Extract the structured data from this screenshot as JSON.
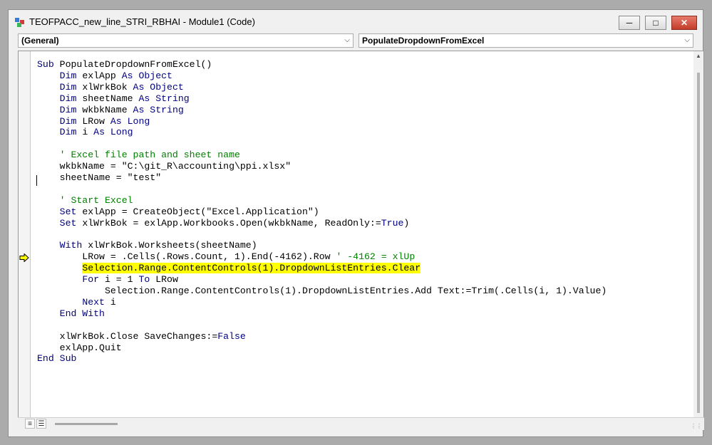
{
  "window": {
    "title": "TEOFPACC_new_line_STRI_RBHAI - Module1 (Code)",
    "controls": {
      "minimize": "─",
      "maximize": "□",
      "close": "✕"
    }
  },
  "dropdowns": {
    "object": {
      "selected": "(General)"
    },
    "procedure": {
      "selected": "PopulateDropdownFromExcel"
    }
  },
  "code": {
    "lines": [
      [
        {
          "t": "Sub",
          "c": "kw"
        },
        {
          "t": " PopulateDropdownFromExcel()"
        }
      ],
      [
        {
          "t": "    "
        },
        {
          "t": "Dim",
          "c": "kw"
        },
        {
          "t": " exlApp "
        },
        {
          "t": "As",
          "c": "kw"
        },
        {
          "t": " "
        },
        {
          "t": "Object",
          "c": "kw"
        }
      ],
      [
        {
          "t": "    "
        },
        {
          "t": "Dim",
          "c": "kw"
        },
        {
          "t": " xlWrkBok "
        },
        {
          "t": "As",
          "c": "kw"
        },
        {
          "t": " "
        },
        {
          "t": "Object",
          "c": "kw"
        }
      ],
      [
        {
          "t": "    "
        },
        {
          "t": "Dim",
          "c": "kw"
        },
        {
          "t": " sheetName "
        },
        {
          "t": "As",
          "c": "kw"
        },
        {
          "t": " "
        },
        {
          "t": "String",
          "c": "kw"
        }
      ],
      [
        {
          "t": "    "
        },
        {
          "t": "Dim",
          "c": "kw"
        },
        {
          "t": " wkbkName "
        },
        {
          "t": "As",
          "c": "kw"
        },
        {
          "t": " "
        },
        {
          "t": "String",
          "c": "kw"
        }
      ],
      [
        {
          "t": "    "
        },
        {
          "t": "Dim",
          "c": "kw"
        },
        {
          "t": " LRow "
        },
        {
          "t": "As",
          "c": "kw"
        },
        {
          "t": " "
        },
        {
          "t": "Long",
          "c": "kw"
        }
      ],
      [
        {
          "t": "    "
        },
        {
          "t": "Dim",
          "c": "kw"
        },
        {
          "t": " i "
        },
        {
          "t": "As",
          "c": "kw"
        },
        {
          "t": " "
        },
        {
          "t": "Long",
          "c": "kw"
        }
      ],
      [],
      [
        {
          "t": "    "
        },
        {
          "t": "' Excel file path and sheet name",
          "c": "cm"
        }
      ],
      [
        {
          "t": "    wkbkName = \"C:\\git_R\\accounting\\ppi.xlsx\""
        }
      ],
      [
        {
          "t": "    sheetName = \"test\""
        }
      ],
      [],
      [
        {
          "t": "    "
        },
        {
          "t": "' Start Excel",
          "c": "cm"
        }
      ],
      [
        {
          "t": "    "
        },
        {
          "t": "Set",
          "c": "kw"
        },
        {
          "t": " exlApp = CreateObject(\"Excel.Application\")"
        }
      ],
      [
        {
          "t": "    "
        },
        {
          "t": "Set",
          "c": "kw"
        },
        {
          "t": " xlWrkBok = exlApp.Workbooks.Open(wkbkName, ReadOnly:="
        },
        {
          "t": "True",
          "c": "kw"
        },
        {
          "t": ")"
        }
      ],
      [],
      [
        {
          "t": "    "
        },
        {
          "t": "With",
          "c": "kw"
        },
        {
          "t": " xlWrkBok.Worksheets(sheetName)"
        }
      ],
      [
        {
          "t": "        LRow = .Cells(.Rows.Count, 1).End(-4162).Row "
        },
        {
          "t": "' -4162 = xlUp",
          "c": "cm"
        }
      ],
      [
        {
          "t": "        "
        },
        {
          "t": "Selection.Range.ContentControls(1).DropdownListEntries.Clear",
          "c": "hl"
        }
      ],
      [
        {
          "t": "        "
        },
        {
          "t": "For",
          "c": "kw"
        },
        {
          "t": " i = 1 "
        },
        {
          "t": "To",
          "c": "kw"
        },
        {
          "t": " LRow"
        }
      ],
      [
        {
          "t": "            Selection.Range.ContentControls(1).DropdownListEntries.Add Text:=Trim(.Cells(i, 1).Value)"
        }
      ],
      [
        {
          "t": "        "
        },
        {
          "t": "Next",
          "c": "kw"
        },
        {
          "t": " i"
        }
      ],
      [
        {
          "t": "    "
        },
        {
          "t": "End With",
          "c": "kw"
        }
      ],
      [],
      [
        {
          "t": "    xlWrkBok.Close SaveChanges:="
        },
        {
          "t": "False",
          "c": "kw"
        }
      ],
      [
        {
          "t": "    exlApp.Quit"
        }
      ],
      [
        {
          "t": "End Sub",
          "c": "kw"
        }
      ]
    ]
  },
  "statusbar": {
    "procedure_view_icon": "procedure-view-icon",
    "module_view_icon": "full-module-view-icon",
    "procedure_view_glyph": "≡",
    "module_view_glyph": "☰"
  },
  "colors": {
    "keyword": "#000080",
    "comment": "#008000",
    "highlight": "#ffff00",
    "close_button": "#c43c2a"
  }
}
